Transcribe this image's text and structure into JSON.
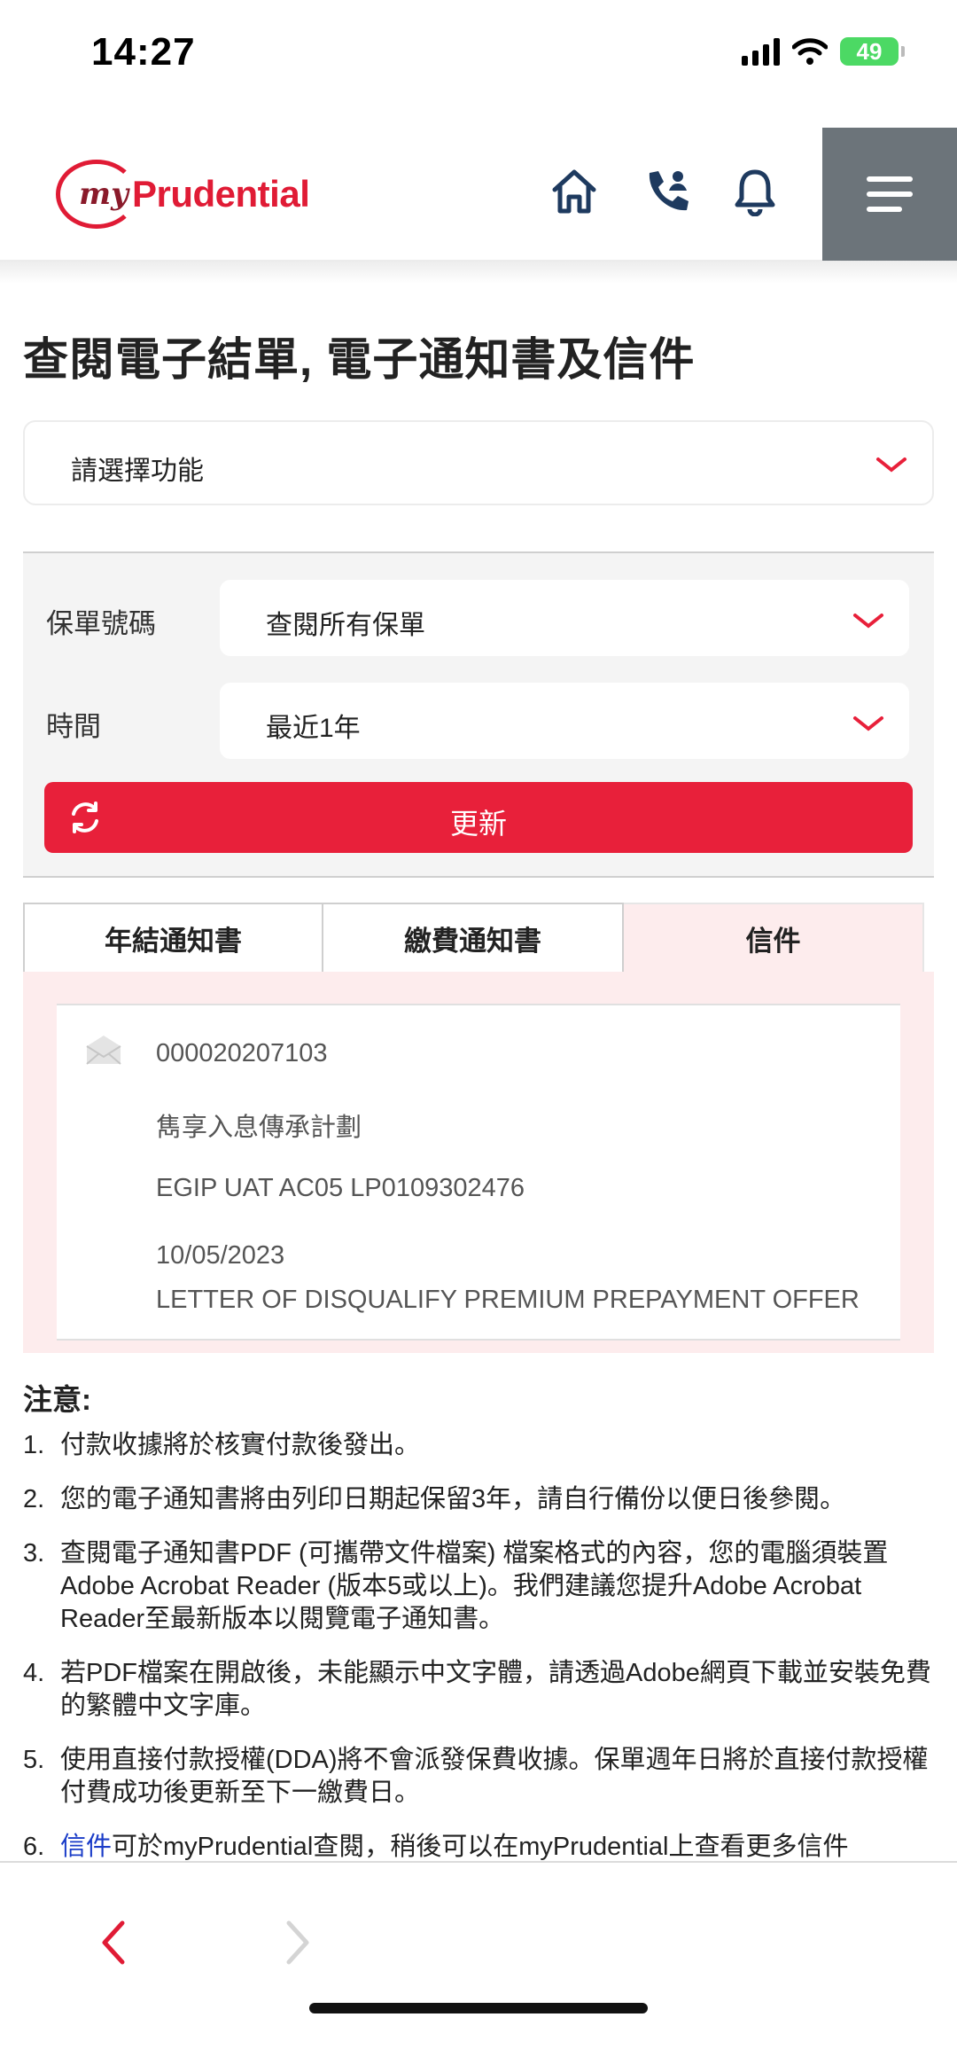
{
  "status_bar": {
    "time": "14:27",
    "battery": "49"
  },
  "header": {
    "logo_prefix": "my",
    "logo_brand": "Prudential"
  },
  "page": {
    "title": "查閱電子結單, 電子通知書及信件"
  },
  "function_select": {
    "placeholder": "請選擇功能"
  },
  "filters": {
    "policy_label": "保單號碼",
    "policy_value": "查閱所有保單",
    "period_label": "時間",
    "period_value": "最近1年",
    "refresh_label": "更新"
  },
  "tabs": [
    {
      "label": "年結通知書",
      "active": false
    },
    {
      "label": "繳費通知書",
      "active": false
    },
    {
      "label": "信件",
      "active": true
    }
  ],
  "letter": {
    "number": "000020207103",
    "plan": "雋享入息傳承計劃",
    "reference": "EGIP UAT AC05 LP0109302476",
    "date": "10/05/2023",
    "subject": "LETTER OF DISQUALIFY PREMIUM PREPAYMENT OFFER"
  },
  "notes": {
    "title": "注意:",
    "items": [
      {
        "num": "1.",
        "text": "付款收據將於核實付款後發出。"
      },
      {
        "num": "2.",
        "text": "您的電子通知書將由列印日期起保留3年，請自行備份以便日後參閱。"
      },
      {
        "num": "3.",
        "text": "查閱電子通知書PDF (可攜帶文件檔案) 檔案格式的內容，您的電腦須裝置Adobe Acrobat Reader (版本5或以上)。我們建議您提升Adobe Acrobat Reader至最新版本以閱覽電子通知書。"
      },
      {
        "num": "4.",
        "text": "若PDF檔案在開啟後，未能顯示中文字體，請透過Adobe網頁下載並安裝免費的繁體中文字庫。"
      },
      {
        "num": "5.",
        "text": "使用直接付款授權(DDA)將不會派發保費收據。保單週年日將於直接付款授權付費成功後更新至下一繳費日。"
      },
      {
        "num": "6.",
        "link": "信件",
        "text": "可於myPrudential查閱，稍後可以在myPrudential上查看更多信件"
      }
    ]
  },
  "colors": {
    "brand_red": "#e8203a",
    "menu_gray": "#6c747a",
    "active_tab_bg": "#fdeced"
  },
  "icons": [
    "signal-icon",
    "wifi-icon",
    "battery-icon",
    "home-icon",
    "phone-icon",
    "bell-icon",
    "menu-icon",
    "chevron-down-icon",
    "refresh-icon",
    "envelope-icon",
    "back-arrow-icon",
    "forward-arrow-icon"
  ]
}
